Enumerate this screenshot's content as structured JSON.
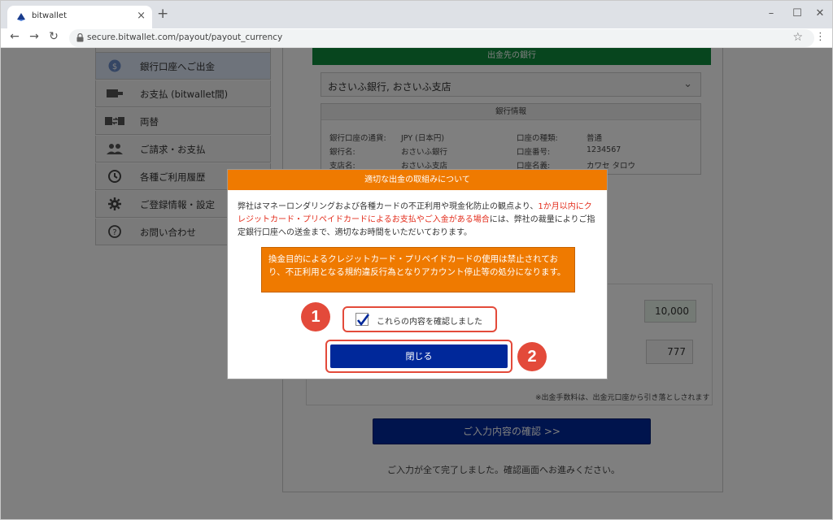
{
  "browser": {
    "tab_title": "bitwallet",
    "url": "secure.bitwallet.com/payout/payout_currency",
    "icons": [
      "bitwallet-favicon",
      "close-icon",
      "new-tab-icon",
      "minimize-icon",
      "maximize-icon",
      "window-close-icon",
      "back-icon",
      "forward-icon",
      "reload-icon",
      "lock-icon",
      "star-icon",
      "menu-icon"
    ]
  },
  "sidebar": {
    "items": [
      {
        "label": "銀行口座へご出金",
        "icon": "coin-icon",
        "active": true
      },
      {
        "label": "お支払 (bitwallet間)",
        "icon": "wallet-icon"
      },
      {
        "label": "両替",
        "icon": "exchange-icon"
      },
      {
        "label": "ご請求・お支払",
        "icon": "users-icon"
      },
      {
        "label": "各種ご利用履歴",
        "icon": "history-icon"
      },
      {
        "label": "ご登録情報・設定",
        "icon": "gear-icon"
      },
      {
        "label": "お問い合わせ",
        "icon": "help-icon"
      }
    ]
  },
  "main": {
    "bank_header": "出金先の銀行",
    "bank_select": "おさいふ銀行, おさいふ支店",
    "bank_info": {
      "title": "銀行情報",
      "rows": [
        {
          "l1": "銀行口座の通貨:",
          "v1": "JPY (日本円)",
          "l2": "口座の種類:",
          "v2": "普通"
        },
        {
          "l1": "銀行名:",
          "v1": "おさいふ銀行",
          "l2": "口座番号:",
          "v2": "1234567"
        },
        {
          "l1": "支店名:",
          "v1": "おさいふ支店",
          "l2": "口座名義:",
          "v2": "カワセ タロウ"
        }
      ]
    },
    "amount": "10,000",
    "fee": "777",
    "fee_note": "※出金手数料は、出金元口座から引き落としされます",
    "confirm_button": "ご入力内容の確認 >>",
    "complete_message": "ご入力が全て完了しました。確認画面へお進みください。"
  },
  "modal": {
    "title": "適切な出金の取組みについて",
    "body_before": "弊社はマネーロンダリングおよび各種カードの不正利用や現金化防止の観点より、",
    "body_red": "1か月以内にクレジットカード・プリペイドカードによるお支払やご入金がある場合",
    "body_after": "には、弊社の裁量によりご指定銀行口座への送金まで、適切なお時間をいただいております。",
    "warning": "換金目的によるクレジットカード・プリペイドカードの使用は禁止されており、不正利用となる規約違反行為となりアカウント停止等の処分になります。",
    "checkbox_label": "これらの内容を確認しました",
    "checkbox_checked": true,
    "close_button": "閉じる"
  },
  "annotations": {
    "badge1": "1",
    "badge2": "2"
  },
  "colors": {
    "accent_orange": "#ef7a00",
    "button_navy": "#00289a",
    "green_header": "#0f8a3c",
    "annotation_red": "#e34a3a"
  }
}
